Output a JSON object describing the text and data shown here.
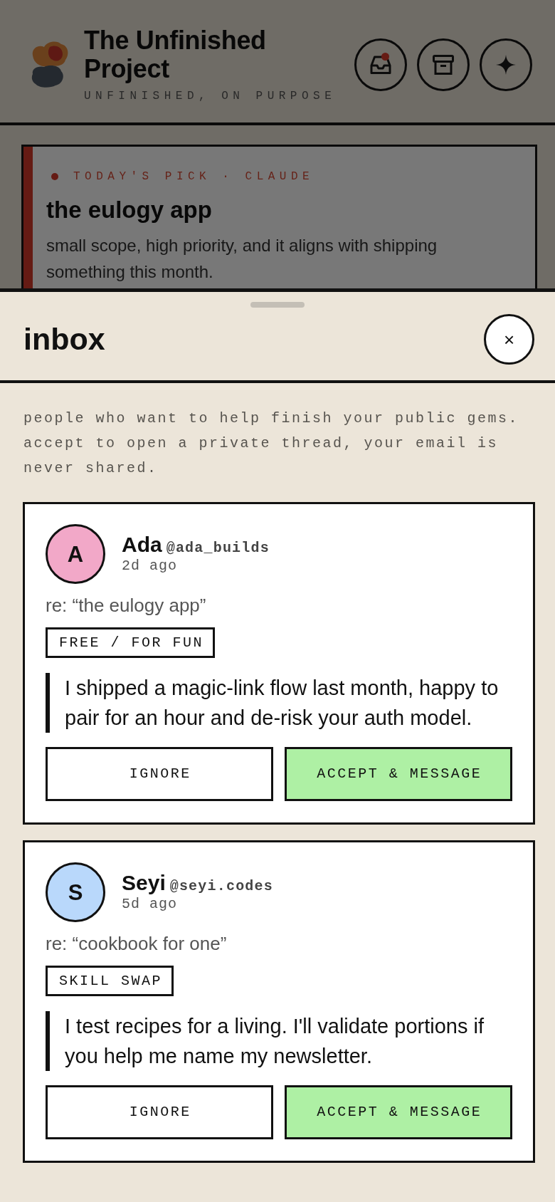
{
  "app": {
    "title": "The Unfinished Project",
    "tagline": "UNFINISHED, ON PURPOSE",
    "actions": [
      {
        "kind": "inbox",
        "badge": true
      },
      {
        "kind": "archive",
        "badge": false
      },
      {
        "kind": "sparkle",
        "badge": false
      }
    ],
    "pick": {
      "label": "TODAY'S PICK · CLAUDE",
      "title": "the eulogy app",
      "reason": "small scope, high priority, and it aligns with shipping something this month."
    }
  },
  "sheet": {
    "title": "inbox",
    "close": "×",
    "intro": "people who want to help finish your public gems. accept to open a private thread, your email is never shared.",
    "requests": [
      {
        "initial": "A",
        "color": "#f2a8c8",
        "name": "Ada",
        "handle": "@ada_builds",
        "time": "2d ago",
        "re": "re: “the eulogy app”",
        "tag": "FREE / FOR FUN",
        "message": "I shipped a magic-link flow last month, happy to pair for an hour and de-risk your auth model.",
        "actions": [
          {
            "label": "IGNORE",
            "kind": "secondary"
          },
          {
            "label": "ACCEPT & MESSAGE",
            "kind": "primary"
          }
        ]
      },
      {
        "initial": "S",
        "color": "#b9d8fb",
        "name": "Seyi",
        "handle": "@seyi.codes",
        "time": "5d ago",
        "re": "re: “cookbook for one”",
        "tag": "SKILL SWAP",
        "message": "I test recipes for a living. I'll validate portions if you help me name my newsletter.",
        "actions": [
          {
            "label": "IGNORE",
            "kind": "secondary"
          },
          {
            "label": "ACCEPT & MESSAGE",
            "kind": "primary"
          }
        ]
      }
    ]
  }
}
